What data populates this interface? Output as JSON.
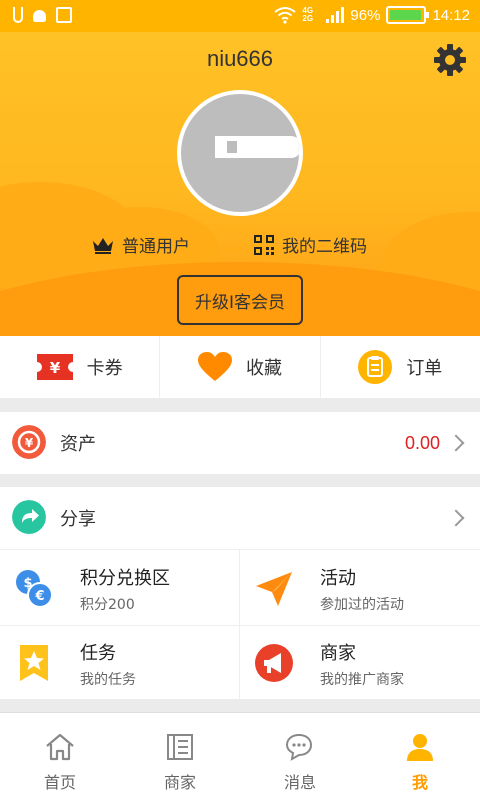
{
  "status_bar": {
    "network": "4G 2G",
    "battery": "96%",
    "battery_level": 0.96,
    "time": "14:12"
  },
  "profile": {
    "username": "niu666",
    "role_label": "普通用户",
    "qr_label": "我的二维码",
    "upgrade_label": "升级I客会员"
  },
  "quick_actions": [
    {
      "label": "卡券",
      "icon": "coupon-icon"
    },
    {
      "label": "收藏",
      "icon": "heart-icon"
    },
    {
      "label": "订单",
      "icon": "clipboard-icon"
    }
  ],
  "assets": {
    "label": "资产",
    "value": "0.00"
  },
  "share": {
    "label": "分享"
  },
  "grid": [
    {
      "title": "积分兑换区",
      "subtitle": "积分200",
      "icon": "currency-exchange-icon"
    },
    {
      "title": "活动",
      "subtitle": "参加过的活动",
      "icon": "paper-plane-icon"
    },
    {
      "title": "任务",
      "subtitle": "我的任务",
      "icon": "star-bookmark-icon"
    },
    {
      "title": "商家",
      "subtitle": "我的推广商家",
      "icon": "megaphone-icon"
    }
  ],
  "tabs": [
    {
      "label": "首页",
      "icon": "home-icon"
    },
    {
      "label": "商家",
      "icon": "store-list-icon"
    },
    {
      "label": "消息",
      "icon": "chat-icon"
    },
    {
      "label": "我",
      "icon": "person-icon",
      "active": true
    }
  ],
  "colors": {
    "accent": "#ffb400",
    "active_tab": "#ff9d00",
    "asset_value": "#e02020"
  }
}
